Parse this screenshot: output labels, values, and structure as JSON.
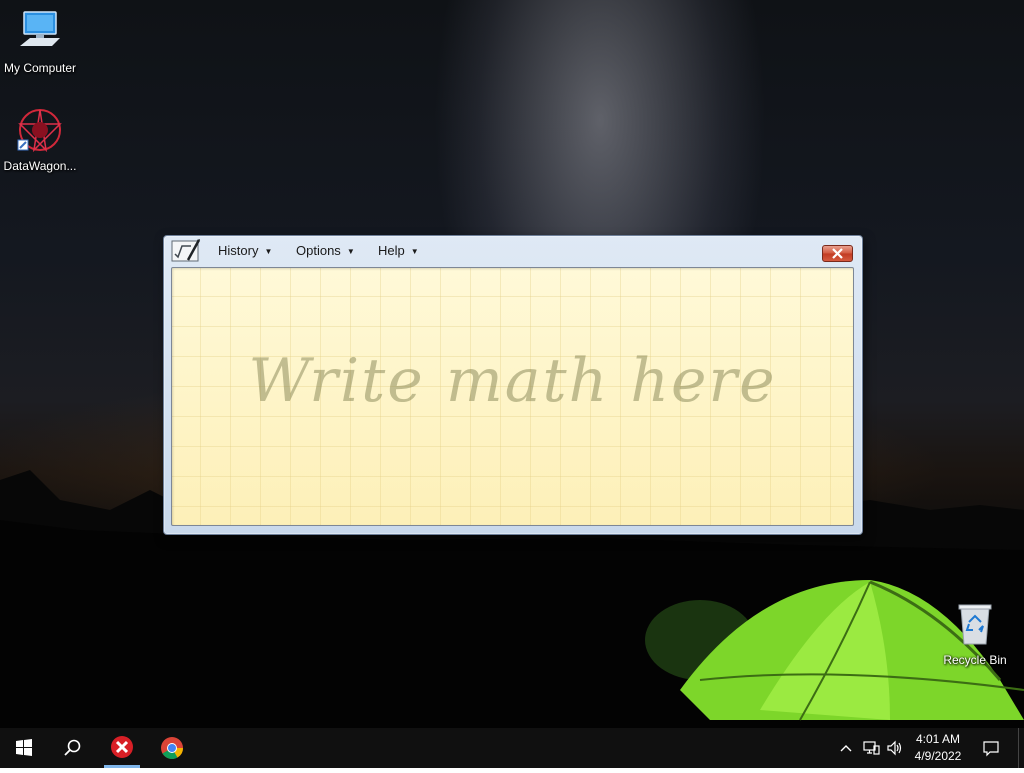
{
  "desktop": {
    "icons": [
      {
        "label": "My Computer",
        "icon": "computer-icon"
      },
      {
        "label": "DataWagon...",
        "icon": "datawagon-icon"
      },
      {
        "label": "Recycle Bin",
        "icon": "recycle-bin-icon"
      }
    ]
  },
  "window": {
    "app_icon": "math-input-panel-icon",
    "menus": [
      {
        "label": "History"
      },
      {
        "label": "Options"
      },
      {
        "label": "Help"
      }
    ],
    "close_icon": "close-icon",
    "pad_hint": "Write math here"
  },
  "taskbar": {
    "start_icon": "windows-start-icon",
    "search_icon": "search-icon",
    "pinned": [
      {
        "icon": "red-x-app-icon",
        "active": true
      },
      {
        "icon": "chrome-icon",
        "active": false
      }
    ],
    "tray": {
      "time": "4:01 AM",
      "date": "4/9/2022",
      "icons": [
        "chevron-up-icon",
        "network-icon",
        "volume-icon",
        "notification-icon"
      ]
    }
  },
  "colors": {
    "pad_background": "#fdf5c4",
    "close_button": "#c13a22",
    "tent_green": "#7dd62a"
  }
}
